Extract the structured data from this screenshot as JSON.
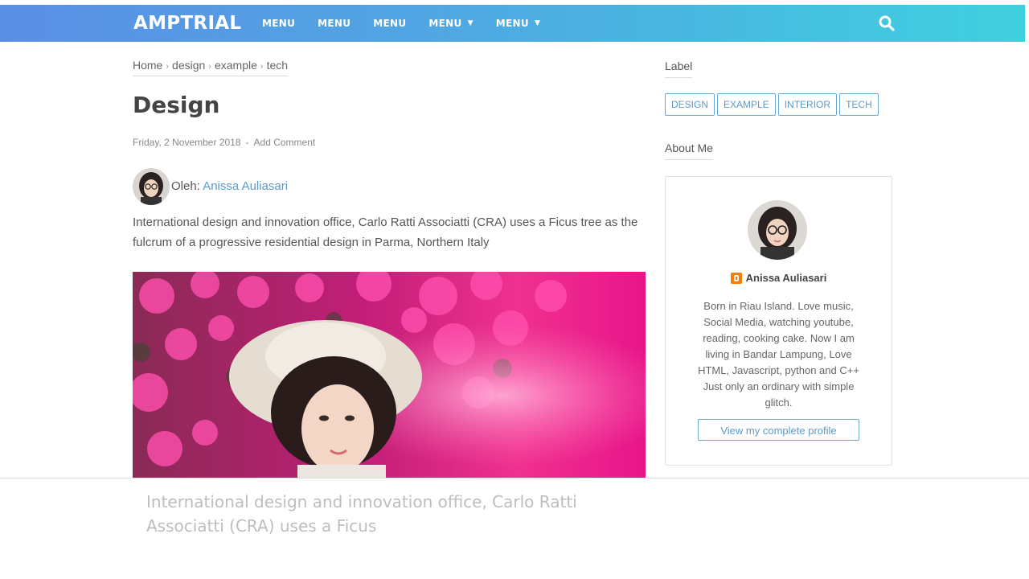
{
  "header": {
    "brand": "AMPTRIAL",
    "nav": [
      {
        "label": "MENU",
        "has_dropdown": false
      },
      {
        "label": "MENU",
        "has_dropdown": false
      },
      {
        "label": "MENU",
        "has_dropdown": false
      },
      {
        "label": "MENU",
        "has_dropdown": true
      },
      {
        "label": "MENU",
        "has_dropdown": true
      }
    ],
    "search_icon": "search-icon",
    "gradient_colors": [
      "#5b8fe6",
      "#3fd0df"
    ]
  },
  "breadcrumb": [
    {
      "label": "Home"
    },
    {
      "label": "design"
    },
    {
      "label": "example"
    },
    {
      "label": "tech"
    }
  ],
  "post": {
    "title": "Design",
    "date": "Friday, 2 November 2018",
    "meta_separator": "-",
    "comment_link": "Add Comment",
    "author_prefix": "Oleh:",
    "author_name": "Anissa Auliasari",
    "excerpt": "International design and innovation office, Carlo Ratti Associatti (CRA) uses a Ficus tree as the fulcrum of a progressive residential design in Parma, Northern Italy"
  },
  "sidebar": {
    "label_title": "Label",
    "tags": [
      "DESIGN",
      "EXAMPLE",
      "INTERIOR",
      "TECH"
    ],
    "about_title": "About Me",
    "profile": {
      "name": "Anissa Auliasari",
      "bio": "Born in Riau Island. Love music, Social Media, watching youtube, reading, cooking cake. Now I am living in Bandar Lampung, Love HTML, Javascript, python and C++ Just only an ordinary with simple glitch.",
      "button_label": "View my complete profile"
    }
  },
  "overlay": {
    "text": "International design and innovation office, Carlo Ratti Associatti (CRA) uses a Ficus"
  },
  "colors": {
    "link": "#5c9bc9",
    "blogger": "#f57d00"
  }
}
